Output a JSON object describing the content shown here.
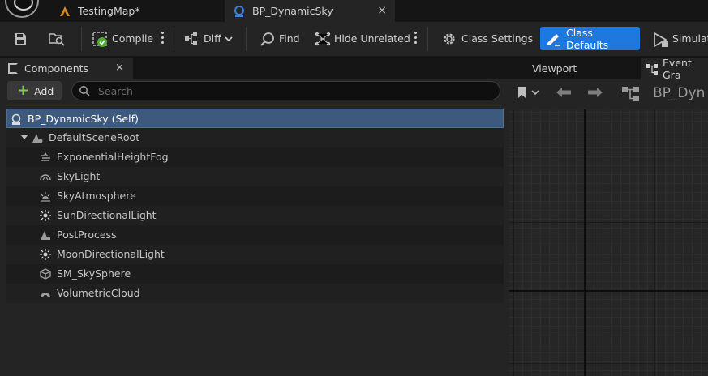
{
  "doc_tabs": [
    {
      "label": "TestingMap*"
    },
    {
      "label": "BP_DynamicSky",
      "close": "×"
    }
  ],
  "toolbar": {
    "compile": "Compile",
    "diff": "Diff",
    "find": "Find",
    "hide_unrelated": "Hide Unrelated",
    "class_settings": "Class Settings",
    "class_defaults": "Class Defaults",
    "simulate": "Simulat"
  },
  "components": {
    "tab_label": "Components",
    "close": "×",
    "add_label": "Add",
    "search_placeholder": "Search",
    "items": [
      {
        "label": "BP_DynamicSky (Self)"
      },
      {
        "label": "DefaultSceneRoot"
      },
      {
        "label": "ExponentialHeightFog"
      },
      {
        "label": "SkyLight"
      },
      {
        "label": "SkyAtmosphere"
      },
      {
        "label": "SunDirectionalLight"
      },
      {
        "label": "PostProcess"
      },
      {
        "label": "MoonDirectionalLight"
      },
      {
        "label": "SM_SkySphere"
      },
      {
        "label": "VolumetricCloud"
      }
    ]
  },
  "right_panel": {
    "viewport_tab": "Viewport",
    "event_graph_tab": "Event Gra",
    "graph_title": "BP_Dyn"
  },
  "colors": {
    "accent": "#1e78dd",
    "selected_row": "#3d5a7d",
    "add_plus": "#7fcf3f"
  }
}
